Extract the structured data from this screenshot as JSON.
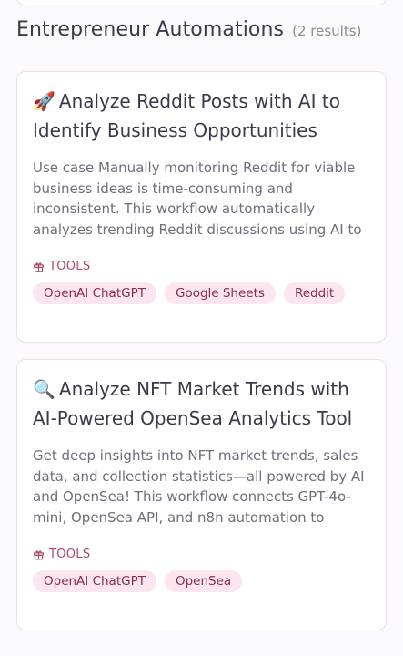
{
  "section": {
    "title": "Entrepreneur Automations",
    "count": "(2 results)"
  },
  "tools_label": "TOOLS",
  "cards": [
    {
      "emoji": "🚀",
      "title": "Analyze Reddit Posts with AI to Identify Business Opportunities",
      "description": "Use case Manually monitoring Reddit for viable business ideas is time-consuming and inconsistent. This workflow automatically analyzes trending Reddit discussions using AI to surface high-potential opportunities, filter irrelevant...",
      "tags": [
        "OpenAI ChatGPT",
        "Google Sheets",
        "Reddit"
      ]
    },
    {
      "emoji": "🔍",
      "title": "Analyze NFT Market Trends with AI-Powered OpenSea Analytics Tool",
      "description": "Get deep insights into NFT market trends, sales data, and collection statistics—all powered by AI and OpenSea! This workflow connects GPT-4o-mini, OpenSea API, and n8n automation to provide real-time analytics on NFT collections, wallet...",
      "tags": [
        "OpenAI ChatGPT",
        "OpenSea"
      ]
    }
  ]
}
